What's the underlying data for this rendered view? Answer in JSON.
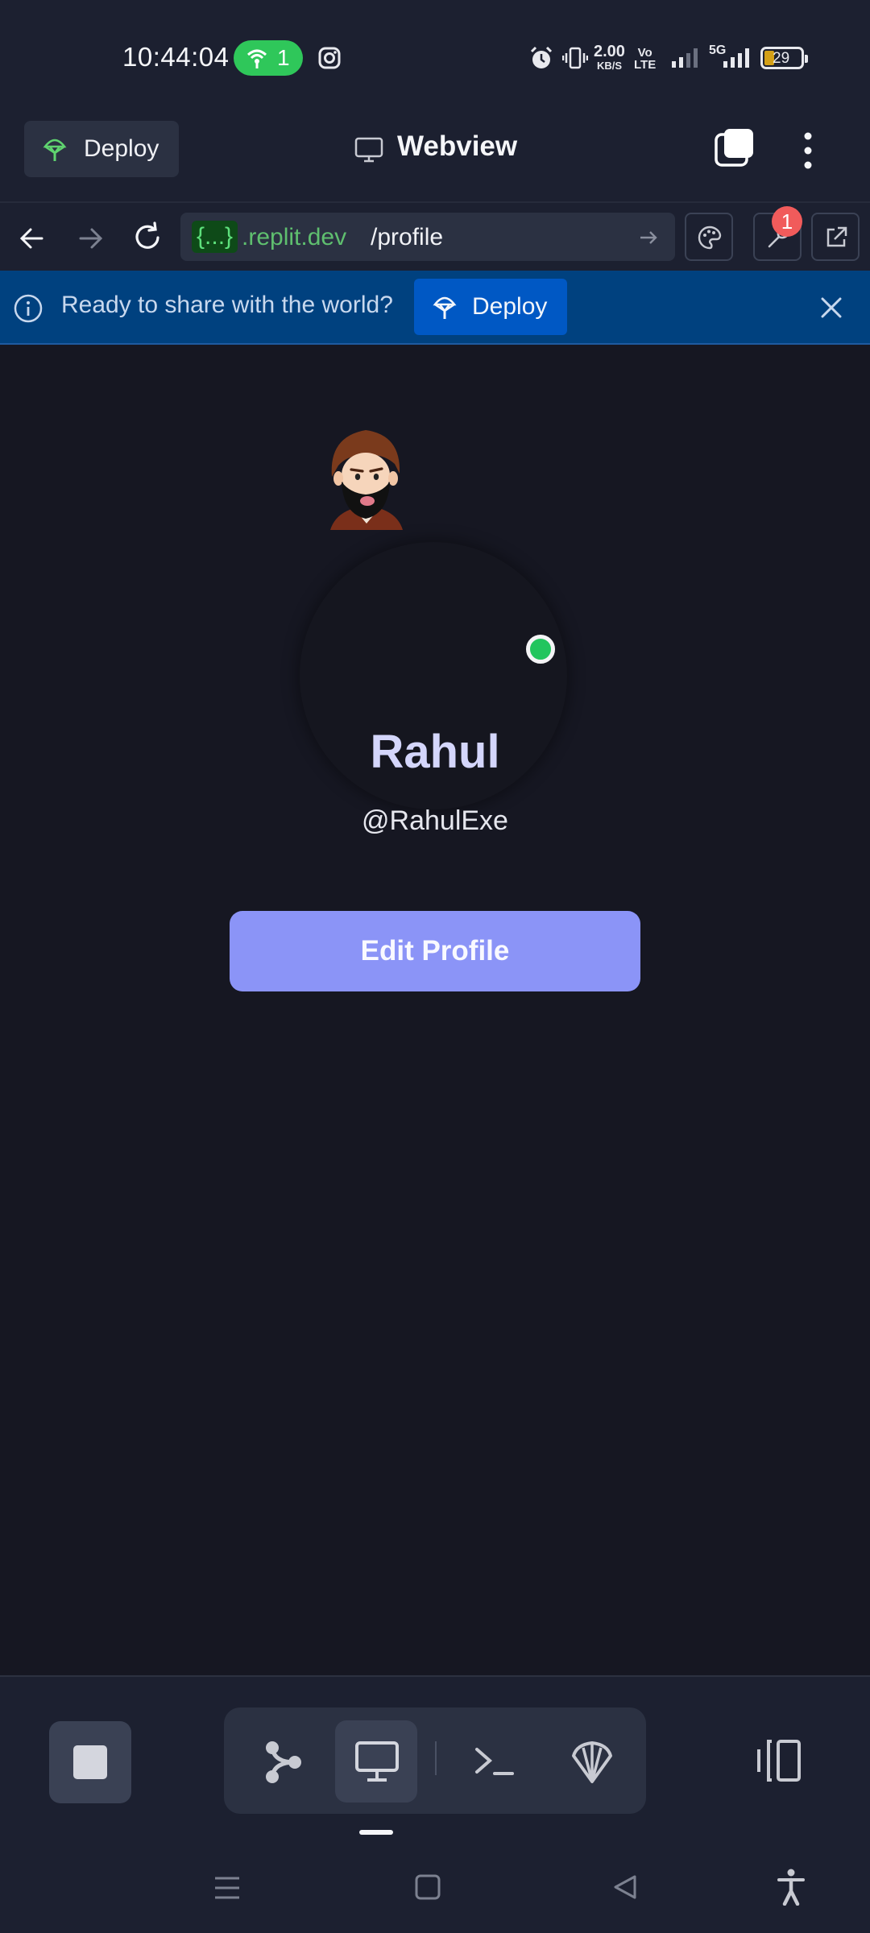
{
  "status_bar": {
    "time": "10:44:04",
    "hotspot_count": "1",
    "net_speed_value": "2.00",
    "net_speed_unit": "KB/S",
    "volte_top": "Vo",
    "volte_mid": "LTE",
    "network": "5G",
    "battery": "29"
  },
  "header": {
    "deploy_label": "Deploy",
    "title": "Webview"
  },
  "address_bar": {
    "url_tag": "{...}",
    "url_host": ".replit.dev",
    "url_path": "/profile",
    "badge_count": "1"
  },
  "banner": {
    "message": "Ready to share with the world?",
    "deploy_label": "Deploy"
  },
  "profile": {
    "name": "Rahul",
    "handle": "@RahulExe",
    "edit_button": "Edit Profile",
    "online_color": "#22c55e"
  },
  "bottom_toolbar": {
    "tabs": [
      "git",
      "webview",
      "shell",
      "agent"
    ],
    "active_tab": "webview"
  },
  "colors": {
    "accent": "#8b94f7",
    "banner_bg": "#00417f",
    "deploy_blue": "#0058c4",
    "background": "#1c2030",
    "webview_bg": "#161722"
  }
}
